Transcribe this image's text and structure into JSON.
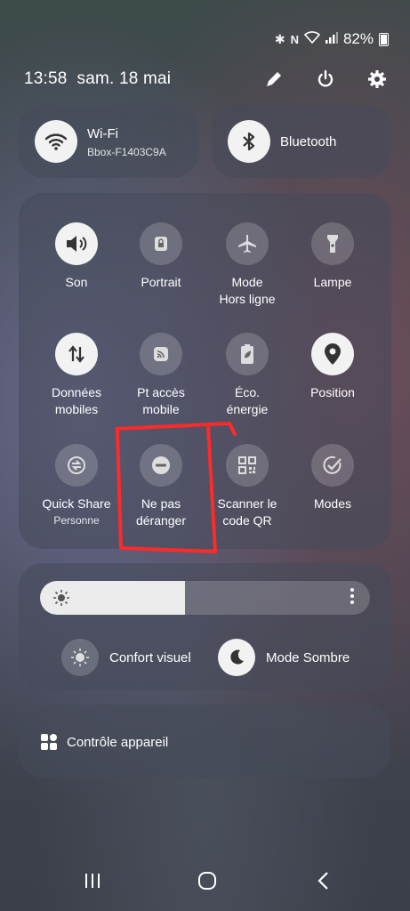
{
  "status": {
    "battery": "82%"
  },
  "header": {
    "time": "13:58",
    "date": "sam. 18 mai"
  },
  "connectivity": {
    "wifi": {
      "title": "Wi-Fi",
      "network": "Bbox-F1403C9A"
    },
    "bluetooth": {
      "title": "Bluetooth"
    }
  },
  "tiles": [
    {
      "label": "Son",
      "icon": "speaker-icon",
      "active": true
    },
    {
      "label": "Portrait",
      "icon": "rotation-lock-icon",
      "active": false
    },
    {
      "label": "Mode\nHors ligne",
      "icon": "airplane-icon",
      "active": false
    },
    {
      "label": "Lampe",
      "icon": "flashlight-icon",
      "active": false
    },
    {
      "label": "Données\nmobiles",
      "icon": "mobile-data-icon",
      "active": true
    },
    {
      "label": "Pt accès\nmobile",
      "icon": "hotspot-icon",
      "active": false
    },
    {
      "label": "Éco.\nénergie",
      "icon": "power-saving-icon",
      "active": false
    },
    {
      "label": "Position",
      "icon": "location-icon",
      "active": true
    },
    {
      "label": "Quick Share",
      "sublabel": "Personne",
      "icon": "quick-share-icon",
      "active": false
    },
    {
      "label": "Ne pas\ndéranger",
      "icon": "do-not-disturb-icon",
      "active": false
    },
    {
      "label": "Scanner le\ncode QR",
      "icon": "qr-code-icon",
      "active": false
    },
    {
      "label": "Modes",
      "icon": "modes-icon",
      "active": false
    }
  ],
  "brightness": {
    "level": 0.44
  },
  "display_options": {
    "eye_comfort": "Confort visuel",
    "dark_mode": "Mode Sombre"
  },
  "device_control": {
    "label": "Contrôle appareil"
  },
  "colors": {
    "tile_on": "#f2f2f2",
    "annotation": "#ff2a2a"
  }
}
